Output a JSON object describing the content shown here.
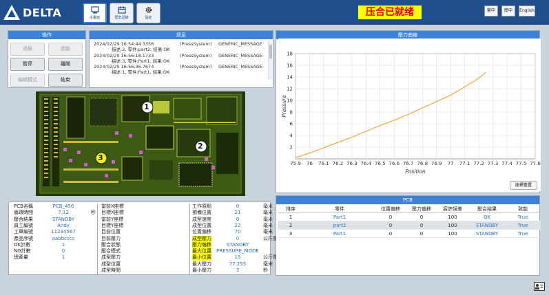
{
  "brand": {
    "logo_text": "DELTA"
  },
  "tabs": [
    {
      "label": "主畫面"
    },
    {
      "label": "歷史記錄"
    },
    {
      "label": "設定"
    }
  ],
  "status_banner": "压合已就绪",
  "languages": [
    "繁中",
    "簡中",
    "English"
  ],
  "operation": {
    "title": "操作",
    "buttons": [
      "退錄",
      "啟動",
      "暫停",
      "離開",
      "編輯模式",
      "結束"
    ]
  },
  "messages": {
    "title": "訊息",
    "lines": [
      {
        "time": "2024/02/29 16:54:44.3356",
        "src": "(PressSystem)",
        "type": "GENERIC_MESSAGE"
      },
      {
        "detail": "描述:2, 零件:part2, 結果:OK"
      },
      {
        "time": "2024/02/29 16:56:18.1733",
        "src": "(PressSystem)",
        "type": "GENERIC_MESSAGE"
      },
      {
        "detail": "描述:3, 零件:Part1, 結果:OK"
      },
      {
        "time": "2024/02/29 16:56:36.7674",
        "src": "(PressSystem)",
        "type": "GENERIC_MESSAGE"
      },
      {
        "detail": "描述:1, 零件:Part1, 結果:OK"
      }
    ]
  },
  "pcb_markers": [
    "1",
    "2",
    "3"
  ],
  "info_col1": [
    {
      "k": "PCB名稱",
      "v": "PCB_456",
      "u": ""
    },
    {
      "k": "循環時間",
      "v": "7.12",
      "u": "秒"
    },
    {
      "k": "壓合結果",
      "v": "STANDBY",
      "u": ""
    },
    {
      "k": "員工編號",
      "v": "Andy",
      "u": ""
    },
    {
      "k": "工單編號",
      "v": "11234567",
      "u": ""
    },
    {
      "k": "產品序號",
      "v": "aabbcccc",
      "u": ""
    },
    {
      "k": "OK計數",
      "v": "1",
      "u": ""
    },
    {
      "k": "NG計數",
      "v": "0",
      "u": ""
    },
    {
      "k": "總產量",
      "v": "1",
      "u": ""
    }
  ],
  "info_col2": [
    {
      "k": "當前X座標",
      "v": "0",
      "u": "毫米"
    },
    {
      "k": "目標X座標",
      "v": "21",
      "u": "毫米"
    },
    {
      "k": "當前Y座標",
      "v": "0",
      "u": "毫米"
    },
    {
      "k": "目標Y座標",
      "v": "22",
      "u": "毫米"
    },
    {
      "k": "目前位置",
      "v": "70",
      "u": "毫米"
    },
    {
      "k": "目前壓力",
      "v": "0",
      "u": "公斤重"
    },
    {
      "k": "壓合狀態",
      "v": "STANDBY",
      "u": ""
    },
    {
      "k": "壓合模式",
      "v": "PRESSURE_MODE",
      "u": ""
    },
    {
      "k": "成型壓力",
      "v": "15",
      "u": "公斤重"
    },
    {
      "k": "成型位置",
      "v": "77.255",
      "u": "毫米"
    },
    {
      "k": "成型時間",
      "v": "3",
      "u": "秒"
    }
  ],
  "info_col3": [
    {
      "k": "工作原點",
      "v": "70",
      "u": "毫米",
      "hl": false
    },
    {
      "k": "預備位置",
      "v": "72",
      "u": "毫米",
      "hl": false
    },
    {
      "k": "成型速度",
      "v": "10",
      "u": "毫米秒",
      "hl": false
    },
    {
      "k": "成型位置",
      "v": "0",
      "u": "毫米",
      "hl": false
    },
    {
      "k": "位置偏移",
      "v": "0",
      "u": "毫米",
      "hl": false
    },
    {
      "k": "成型壓力",
      "v": "20",
      "u": "公斤重",
      "hl": true
    },
    {
      "k": "壓力偏移",
      "v": "0",
      "u": "公斤重",
      "hl": true
    },
    {
      "k": "最大位置",
      "v": "80",
      "u": "毫米",
      "hl": true
    },
    {
      "k": "最小位置",
      "v": "0",
      "u": "毫米",
      "hl": true
    },
    {
      "k": "最大壓力",
      "v": "100",
      "u": "公斤重",
      "hl": false
    },
    {
      "k": "最小壓力",
      "v": "0",
      "u": "公斤重",
      "hl": false
    }
  ],
  "chart_panel": {
    "title": "壓力曲線",
    "reset_label": "座標重置"
  },
  "chart_data": {
    "type": "line",
    "xlabel": "Position",
    "ylabel": "Pressure",
    "xlim": [
      75.9,
      77.6
    ],
    "ylim": [
      0,
      18
    ],
    "xticks": [
      75.9,
      76,
      76.1,
      76.2,
      76.3,
      76.4,
      76.5,
      76.6,
      76.7,
      76.8,
      76.9,
      77,
      77.1,
      77.2,
      77.3,
      77.4,
      77.5,
      77.6
    ],
    "yticks": [
      2,
      4,
      6,
      8,
      10,
      12,
      14,
      16,
      18
    ],
    "grid": true,
    "color": "#f0a030",
    "x": [
      75.9,
      76.0,
      76.1,
      76.2,
      76.3,
      76.4,
      76.5,
      76.6,
      76.7,
      76.8,
      76.9,
      77.0,
      77.1,
      77.2,
      77.25
    ],
    "y": [
      0.2,
      1.0,
      1.9,
      2.8,
      3.7,
      4.7,
      5.7,
      6.6,
      7.6,
      8.7,
      9.8,
      10.9,
      12.3,
      13.8,
      14.8
    ]
  },
  "pcb_table": {
    "title": "PCB",
    "columns": [
      "排序",
      "零件",
      "位置偏移",
      "壓力偏移",
      "容許誤差",
      "壓合結果",
      "致能"
    ],
    "rows": [
      [
        "1",
        "Part1",
        "0",
        "0",
        "100",
        "OK",
        "True"
      ],
      [
        "2",
        "part2",
        "0",
        "0",
        "100",
        "STANDBY",
        "True"
      ],
      [
        "3",
        "Part1",
        "0",
        "0",
        "100",
        "STANDBY",
        "True"
      ]
    ]
  }
}
